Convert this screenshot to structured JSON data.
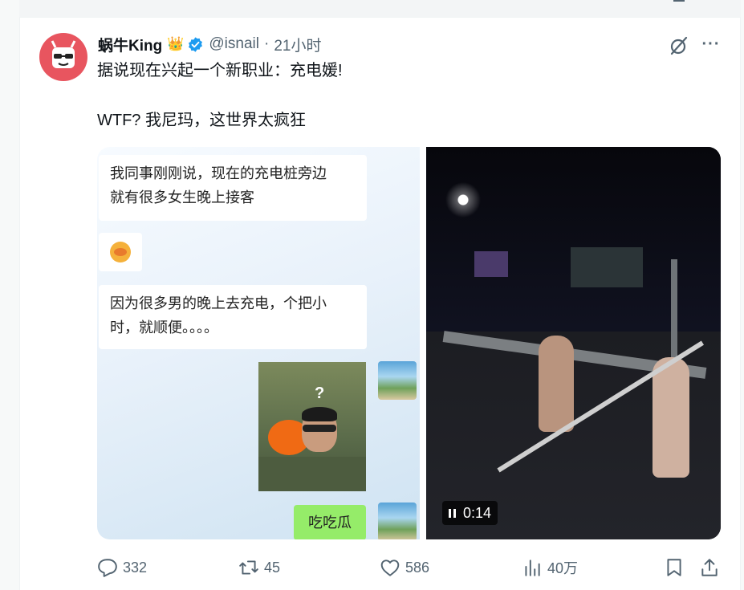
{
  "post": {
    "author_name": "蜗牛King",
    "author_badge": "👑",
    "handle": "@isnail",
    "separator": "·",
    "time": "21小时",
    "text_line1": "据说现在兴起一个新职业：充电媛!",
    "text_line2": "WTF? 我尼玛，这世界太疯狂"
  },
  "media": {
    "chat": {
      "message1_line1": "我同事刚刚说，现在的充电桩旁边",
      "message1_line2": "就有很多女生晚上接客",
      "message3_line1": "因为很多男的晚上去充电，个把小",
      "message3_line2": "时，就顺便。。。。",
      "sticker_text": "?",
      "reply": "吃吃瓜"
    },
    "video": {
      "timer": "0:14"
    }
  },
  "actions": {
    "replies": "332",
    "reposts": "45",
    "likes": "586",
    "views": "40万"
  },
  "colors": {
    "accent": "#1d9bf0",
    "secondary_text": "#536471",
    "avatar_bg": "#e8555f",
    "wechat_green": "#95ec69"
  },
  "icons": {
    "verified": "verified-badge-icon",
    "grok": "grok-icon",
    "more": "more-icon",
    "reply": "reply-icon",
    "repost": "repost-icon",
    "like": "heart-icon",
    "views": "views-icon",
    "bookmark": "bookmark-icon",
    "share": "share-icon"
  }
}
